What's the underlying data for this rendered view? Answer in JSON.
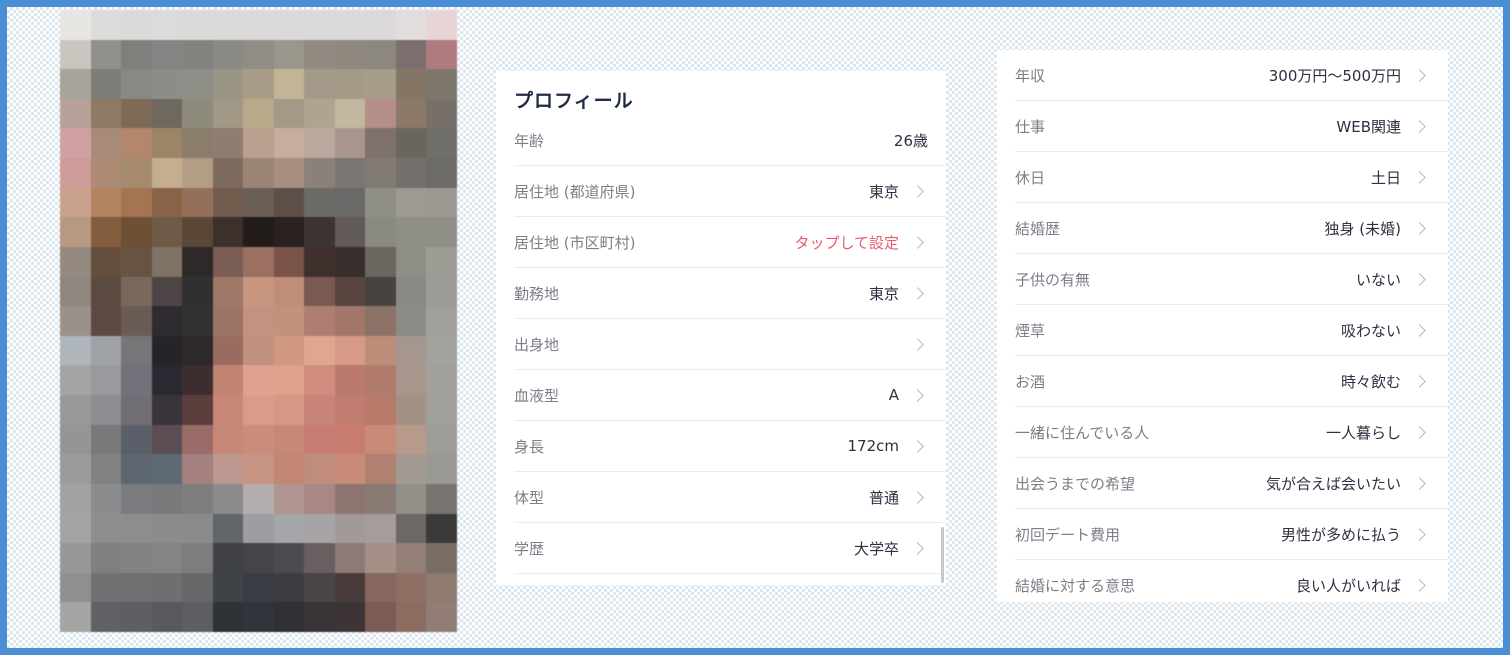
{
  "photo": {
    "description_icon": "pixelated-photo",
    "columns": 13,
    "rows": 21,
    "pixels": [
      "#e8e6e3",
      "#dedcda",
      "#dcdad8",
      "#dddbd9",
      "#dcdad8",
      "#dcdad8",
      "#dcdad8",
      "#dcdad8",
      "#dcdad8",
      "#dcdad8",
      "#dbd9d7",
      "#e3dcdc",
      "#e7d4d6",
      "#c9c6c0",
      "#8f8f8b",
      "#7f7f7b",
      "#828583",
      "#838480",
      "#8b8a84",
      "#8f8d86",
      "#9a968c",
      "#918b81",
      "#8f887f",
      "#8c877f",
      "#7a6e6e",
      "#b07b7f",
      "#a7a49c",
      "#7c7d78",
      "#868984",
      "#8a8d88",
      "#8f8f88",
      "#9b9586",
      "#a99d88",
      "#c2b597",
      "#a39a8a",
      "#a39b88",
      "#a69e8a",
      "#857565",
      "#7e776c",
      "#b7a198",
      "#8e7866",
      "#7e6a56",
      "#6f685e",
      "#8e8a79",
      "#a29886",
      "#b8a98a",
      "#a29a86",
      "#b0a490",
      "#c3b7a0",
      "#b58e88",
      "#8c7868",
      "#77706a",
      "#cfa1a1",
      "#a88b76",
      "#b4876c",
      "#9d8466",
      "#8a7d6c",
      "#8f7d70",
      "#bca08f",
      "#c6ad9d",
      "#bba99d",
      "#a8968c",
      "#7f716e",
      "#6b655f",
      "#6f6e68",
      "#cd9c98",
      "#ad8b74",
      "#a68a6e",
      "#c4ae8f",
      "#b39d84",
      "#7e6b5f",
      "#9d8576",
      "#a88f82",
      "#8a807c",
      "#7b7674",
      "#807a72",
      "#75706b",
      "#6c6b66",
      "#c9a08b",
      "#b4845f",
      "#a57451",
      "#8a6449",
      "#94705a",
      "#725b4d",
      "#6a5e57",
      "#5d4f48",
      "#6c6a65",
      "#6a6967",
      "#8f8f88",
      "#9c9a93",
      "#9a9891",
      "#b79883",
      "#845d3e",
      "#6e5037",
      "#6e5a46",
      "#5a4736",
      "#3b302c",
      "#221c1b",
      "#2a2221",
      "#3d3433",
      "#625a56",
      "#8b8a82",
      "#908f87",
      "#8f8e87",
      "#958a7f",
      "#664e3c",
      "#675342",
      "#807366",
      "#2e2828",
      "#7a5e55",
      "#9b7061",
      "#7a5448",
      "#3f302d",
      "#382e2b",
      "#6a6660",
      "#8e8e87",
      "#9d9c95",
      "#8f8680",
      "#5b4a3f",
      "#7a685b",
      "#4d4545",
      "#303030",
      "#a07868",
      "#c8957e",
      "#c08d78",
      "#7a5a50",
      "#584540",
      "#494340",
      "#8a8983",
      "#9c9b95",
      "#9a918b",
      "#5a4a42",
      "#6a5c54",
      "#2e2c30",
      "#323030",
      "#9c7466",
      "#c49282",
      "#c2927e",
      "#ae7e70",
      "#a27668",
      "#8d7268",
      "#8d8b85",
      "#a09f99",
      "#aeb6bb",
      "#9fa3a8",
      "#767578",
      "#262428",
      "#2e2a2c",
      "#9a6c60",
      "#c2907e",
      "#d09880",
      "#e0a690",
      "#d69a86",
      "#c08c7a",
      "#a69690",
      "#a3a39d",
      "#a5a4a4",
      "#9a99a0",
      "#74717a",
      "#2a2830",
      "#3e2d2e",
      "#c08470",
      "#e0a290",
      "#e0a08a",
      "#d08c7e",
      "#bb7a6e",
      "#b27c6c",
      "#a8958c",
      "#a1a09b",
      "#999898",
      "#8d8c92",
      "#716e76",
      "#38343a",
      "#5b3e3c",
      "#c88678",
      "#dc9a88",
      "#d89684",
      "#c88478",
      "#c07c70",
      "#b87a6a",
      "#a49185",
      "#a09f9a",
      "#959595",
      "#79797b",
      "#5b5f69",
      "#5a4e54",
      "#9a6c68",
      "#c88878",
      "#cb8c7c",
      "#c88878",
      "#c67c72",
      "#c87c70",
      "#ca8a78",
      "#b89a8a",
      "#9e9d97",
      "#9a9b9c",
      "#818282",
      "#5c6570",
      "#5e6a75",
      "#a4807e",
      "#bc9890",
      "#c79484",
      "#c28672",
      "#c08c7c",
      "#c88c78",
      "#b08070",
      "#a39a93",
      "#9a9994",
      "#a1a2a4",
      "#8b8c8d",
      "#7b7c80",
      "#7a7a7c",
      "#7f7e7e",
      "#8d8a8a",
      "#b4adad",
      "#b09690",
      "#a78882",
      "#8e7470",
      "#8a7a74",
      "#939089",
      "#77746f",
      "#a3a4a6",
      "#8d8e90",
      "#8c8d8f",
      "#8b8c8e",
      "#8a8b8d",
      "#616469",
      "#9d9ea4",
      "#a6a7ab",
      "#a7a4a6",
      "#a29a9a",
      "#a49d9a",
      "#6b6866",
      "#3a3a3a",
      "#969798",
      "#7e7f80",
      "#828385",
      "#838486",
      "#7c7d7f",
      "#3f4147",
      "#44444a",
      "#4e4b50",
      "#6a5f60",
      "#8d7a78",
      "#a58f86",
      "#947f76",
      "#7a6d66",
      "#8e8f90",
      "#707172",
      "#6f7072",
      "#6e6f71",
      "#666769",
      "#3f4247",
      "#393c42",
      "#3d3c40",
      "#4b4446",
      "#4a3c3a",
      "#87675e",
      "#8f6f64",
      "#8f7a70",
      "#a5a5a4",
      "#606164",
      "#5e5f62",
      "#58595c",
      "#5d5e61",
      "#2f3237",
      "#31343a",
      "#303036",
      "#3a3438",
      "#3c3436",
      "#7a5c54",
      "#8c6c60",
      "#917d74"
    ]
  },
  "profile": {
    "title": "プロフィール",
    "rows": [
      {
        "label": "年齢",
        "value": "26歳",
        "chevron": false,
        "accent": false
      },
      {
        "label": "居住地 (都道府県)",
        "value": "東京",
        "chevron": true,
        "accent": false
      },
      {
        "label": "居住地 (市区町村)",
        "value": "タップして設定",
        "chevron": true,
        "accent": true
      },
      {
        "label": "勤務地",
        "value": "東京",
        "chevron": true,
        "accent": false
      },
      {
        "label": "出身地",
        "value": "",
        "chevron": true,
        "accent": false
      },
      {
        "label": "血液型",
        "value": "A",
        "chevron": true,
        "accent": false
      },
      {
        "label": "身長",
        "value": "172cm",
        "chevron": true,
        "accent": false
      },
      {
        "label": "体型",
        "value": "普通",
        "chevron": true,
        "accent": false
      },
      {
        "label": "学歴",
        "value": "大学卒",
        "chevron": true,
        "accent": false
      }
    ]
  },
  "details": {
    "rows": [
      {
        "label": "年収",
        "value": "300万円〜500万円",
        "chevron": true
      },
      {
        "label": "仕事",
        "value": "WEB関連",
        "chevron": true
      },
      {
        "label": "休日",
        "value": "土日",
        "chevron": true
      },
      {
        "label": "結婚歴",
        "value": "独身 (未婚)",
        "chevron": true
      },
      {
        "label": "子供の有無",
        "value": "いない",
        "chevron": true
      },
      {
        "label": "煙草",
        "value": "吸わない",
        "chevron": true
      },
      {
        "label": "お酒",
        "value": "時々飲む",
        "chevron": true
      },
      {
        "label": "一緒に住んでいる人",
        "value": "一人暮らし",
        "chevron": true
      },
      {
        "label": "出会うまでの希望",
        "value": "気が合えば会いたい",
        "chevron": true
      },
      {
        "label": "初回デート費用",
        "value": "男性が多めに払う",
        "chevron": true
      },
      {
        "label": "結婚に対する意思",
        "value": "良い人がいれば",
        "chevron": true
      }
    ]
  },
  "colors": {
    "border": "#4a8fd6",
    "accent": "#e85b6e",
    "label": "#7a7f88",
    "value": "#2b3140"
  }
}
